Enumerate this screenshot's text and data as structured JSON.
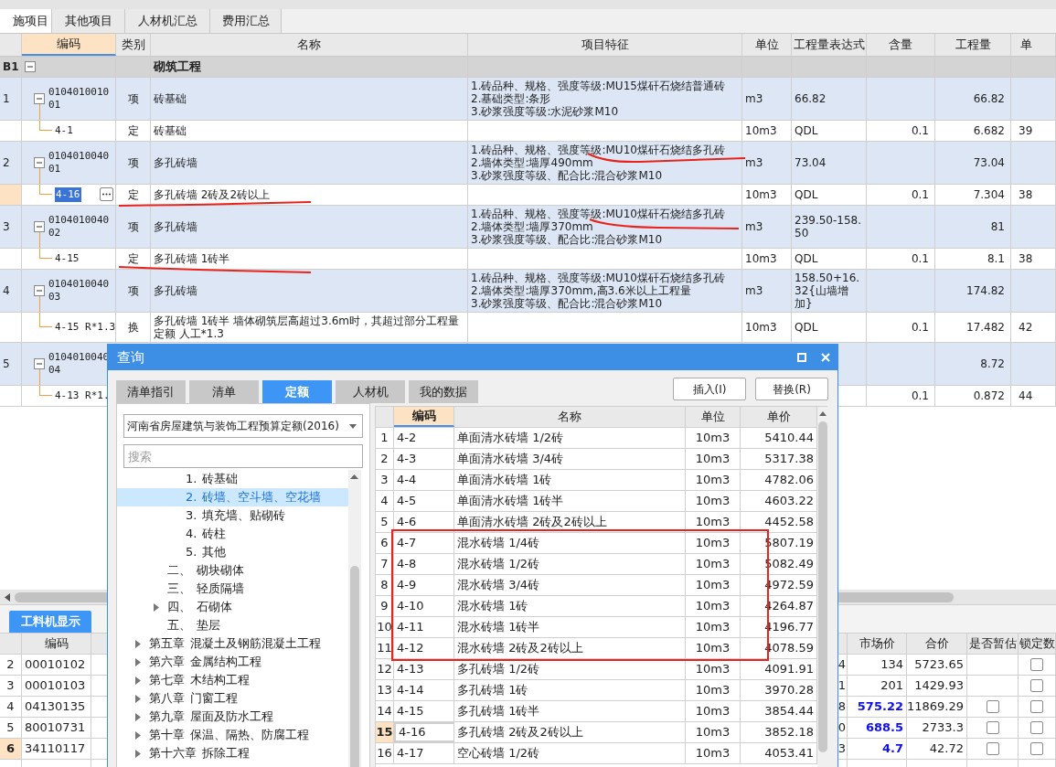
{
  "top_tabs": [
    {
      "label": "施项目",
      "selected": true
    },
    {
      "label": "其他项目",
      "selected": false
    },
    {
      "label": "人材机汇总",
      "selected": false
    },
    {
      "label": "费用汇总",
      "selected": false
    }
  ],
  "main_table": {
    "columns": [
      "",
      "编码",
      "类别",
      "名称",
      "项目特征",
      "单位",
      "工程量表达式",
      "含量",
      "工程量",
      "单"
    ],
    "rows": [
      {
        "kind": "section",
        "num": "B1",
        "expanded": true,
        "name": "砌筑工程",
        "selected": false
      },
      {
        "kind": "item",
        "num": "1",
        "code": "010401001001",
        "expanded": true,
        "type": "项",
        "name": "砖基础",
        "features": [
          "1.砖品种、规格、强度等级:MU15煤矸石烧结普通砖",
          "2.基础类型:条形",
          "3.砂浆强度等级:水泥砂浆M10"
        ],
        "unit": "m3",
        "expr": "66.82",
        "qty": "66.82",
        "selected": false
      },
      {
        "kind": "quota",
        "code": "4-1",
        "type": "定",
        "name": "砖基础",
        "unit": "10m3",
        "expr": "QDL",
        "content": "0.1",
        "qty": "6.682",
        "price": "39",
        "selected": false
      },
      {
        "kind": "item",
        "num": "2",
        "code": "010401004001",
        "expanded": true,
        "type": "项",
        "name": "多孔砖墙",
        "features": [
          "1.砖品种、规格、强度等级:MU10煤矸石烧结多孔砖",
          "2.墙体类型:墙厚490mm",
          "3.砂浆强度等级、配合比:混合砂浆M10"
        ],
        "unit": "m3",
        "expr": "73.04",
        "qty": "73.04",
        "selected": false
      },
      {
        "kind": "quota",
        "code": "4-16",
        "type": "定",
        "name": "多孔砖墙 2砖及2砖以上",
        "unit": "10m3",
        "expr": "QDL",
        "content": "0.1",
        "qty": "7.304",
        "price": "38",
        "selected": true
      },
      {
        "kind": "item",
        "num": "3",
        "code": "010401004002",
        "expanded": true,
        "type": "项",
        "name": "多孔砖墙",
        "features": [
          "1.砖品种、规格、强度等级:MU10煤矸石烧结多孔砖",
          "2.墙体类型:墙厚370mm",
          "3.砂浆强度等级、配合比:混合砂浆M10"
        ],
        "unit": "m3",
        "expr": "239.50-158.50",
        "qty": "81",
        "selected": false
      },
      {
        "kind": "quota",
        "code": "4-15",
        "type": "定",
        "name": "多孔砖墙 1砖半",
        "unit": "10m3",
        "expr": "QDL",
        "content": "0.1",
        "qty": "8.1",
        "price": "38",
        "selected": false
      },
      {
        "kind": "item",
        "num": "4",
        "code": "010401004003",
        "expanded": true,
        "type": "项",
        "name": "多孔砖墙",
        "features": [
          "1.砖品种、规格、强度等级:MU10煤矸石烧结多孔砖",
          "2.墙体类型:墙厚370mm,高3.6米以上工程量",
          "3.砂浆强度等级、配合比:混合砂浆M10"
        ],
        "unit": "m3",
        "expr": "158.50+16.32{山墙增加}",
        "qty": "174.82",
        "selected": false
      },
      {
        "kind": "quota",
        "code": "4-15 R*1.3",
        "type": "换",
        "name": "多孔砖墙 1砖半  墙体砌筑层高超过3.6m时，其超过部分工程量定额 人工*1.3",
        "unit": "10m3",
        "expr": "QDL",
        "content": "0.1",
        "qty": "17.482",
        "price": "42",
        "selected": false
      },
      {
        "kind": "item",
        "num": "5",
        "code": "010401004004",
        "expanded": true,
        "qty": "8.72",
        "selected": false
      },
      {
        "kind": "quota",
        "code": "4-13 R*1.",
        "content": "0.1",
        "qty": "0.872",
        "price": "44",
        "selected": false
      }
    ]
  },
  "dialog": {
    "title": "查询",
    "tabs": [
      {
        "label": "清单指引",
        "selected": false
      },
      {
        "label": "清单",
        "selected": false
      },
      {
        "label": "定额",
        "selected": true
      },
      {
        "label": "人材机",
        "selected": false
      },
      {
        "label": "我的数据",
        "selected": false
      }
    ],
    "buttons": [
      "插入(I)",
      "替换(R)"
    ],
    "library": "河南省房屋建筑与装饰工程预算定额(2016)",
    "search_placeholder": "搜索",
    "tree": [
      {
        "children": [
          {
            "children": [
              {
                "num": "1.",
                "label": "砖基础",
                "selected": false
              },
              {
                "num": "2.",
                "label": "砖墙、空斗墙、空花墙",
                "selected": true
              },
              {
                "num": "3.",
                "label": "填充墙、贴砌砖",
                "selected": false
              },
              {
                "num": "4.",
                "label": "砖柱",
                "selected": false
              },
              {
                "num": "5.",
                "label": "其他",
                "selected": false
              }
            ]
          },
          {
            "num": "二、",
            "label": "砌块砌体",
            "selected": false
          },
          {
            "num": "三、",
            "label": "轻质隔墙",
            "selected": false
          },
          {
            "num": "四、",
            "label": "石砌体",
            "expanded": false,
            "selected": false
          },
          {
            "num": "五、",
            "label": "垫层",
            "selected": false
          }
        ]
      },
      {
        "num": "第五章",
        "label": "混凝土及钢筋混凝土工程",
        "expanded": false,
        "selected": false
      },
      {
        "num": "第六章",
        "label": "金属结构工程",
        "expanded": false,
        "selected": false
      },
      {
        "num": "第七章",
        "label": "木结构工程",
        "expanded": false,
        "selected": false
      },
      {
        "num": "第八章",
        "label": "门窗工程",
        "expanded": false,
        "selected": false
      },
      {
        "num": "第九章",
        "label": "屋面及防水工程",
        "expanded": false,
        "selected": false
      },
      {
        "num": "第十章",
        "label": "保温、隔热、防腐工程",
        "expanded": false,
        "selected": false
      },
      {
        "num": "第十六章",
        "label": "拆除工程",
        "expanded": false,
        "selected": false
      }
    ],
    "table": {
      "columns": [
        "编码",
        "名称",
        "单位",
        "单价"
      ],
      "rows": [
        {
          "num": "1",
          "code": "4-2",
          "name": "单面清水砖墙 1/2砖",
          "unit": "10m3",
          "price": "5410.44",
          "selected": false
        },
        {
          "num": "2",
          "code": "4-3",
          "name": "单面清水砖墙 3/4砖",
          "unit": "10m3",
          "price": "5317.38",
          "selected": false
        },
        {
          "num": "3",
          "code": "4-4",
          "name": "单面清水砖墙 1砖",
          "unit": "10m3",
          "price": "4782.06",
          "selected": false
        },
        {
          "num": "4",
          "code": "4-5",
          "name": "单面清水砖墙 1砖半",
          "unit": "10m3",
          "price": "4603.22",
          "selected": false
        },
        {
          "num": "5",
          "code": "4-6",
          "name": "单面清水砖墙 2砖及2砖以上",
          "unit": "10m3",
          "price": "4452.58",
          "selected": false
        },
        {
          "num": "6",
          "code": "4-7",
          "name": "混水砖墙 1/4砖",
          "unit": "10m3",
          "price": "5807.19",
          "selected": false
        },
        {
          "num": "7",
          "code": "4-8",
          "name": "混水砖墙 1/2砖",
          "unit": "10m3",
          "price": "5082.49",
          "selected": false
        },
        {
          "num": "8",
          "code": "4-9",
          "name": "混水砖墙 3/4砖",
          "unit": "10m3",
          "price": "4972.59",
          "selected": false
        },
        {
          "num": "9",
          "code": "4-10",
          "name": "混水砖墙 1砖",
          "unit": "10m3",
          "price": "4264.87",
          "selected": false
        },
        {
          "num": "10",
          "code": "4-11",
          "name": "混水砖墙 1砖半",
          "unit": "10m3",
          "price": "4196.77",
          "selected": false
        },
        {
          "num": "11",
          "code": "4-12",
          "name": "混水砖墙 2砖及2砖以上",
          "unit": "10m3",
          "price": "4078.59",
          "selected": false
        },
        {
          "num": "12",
          "code": "4-13",
          "name": "多孔砖墙 1/2砖",
          "unit": "10m3",
          "price": "4091.91",
          "selected": false
        },
        {
          "num": "13",
          "code": "4-14",
          "name": "多孔砖墙 1砖",
          "unit": "10m3",
          "price": "3970.28",
          "selected": false
        },
        {
          "num": "14",
          "code": "4-15",
          "name": "多孔砖墙 1砖半",
          "unit": "10m3",
          "price": "3854.44",
          "selected": false
        },
        {
          "num": "15",
          "code": "4-16",
          "name": "多孔砖墙 2砖及2砖以上",
          "unit": "10m3",
          "price": "3852.18",
          "selected": true
        },
        {
          "num": "16",
          "code": "4-17",
          "name": "空心砖墙 1/2砖",
          "unit": "10m3",
          "price": "4053.41",
          "selected": false
        }
      ]
    }
  },
  "bottom_panel": {
    "tab": "工料机显示",
    "columns": [
      "编码",
      "市场价",
      "合价",
      "是否暂估",
      "锁定数"
    ],
    "rows": [
      {
        "num": "2",
        "code": "00010102",
        "column_4": "4",
        "market": "134",
        "market_changed": false,
        "total": "5723.65",
        "locked": false,
        "selected": false
      },
      {
        "num": "3",
        "code": "00010103",
        "column_4": "1",
        "market": "201",
        "market_changed": false,
        "total": "1429.93",
        "locked": false,
        "selected": false
      },
      {
        "num": "4",
        "code": "04130135",
        "column_4": "8",
        "market": "575.22",
        "market_changed": true,
        "total": "11869.29",
        "estimated": false,
        "locked": false,
        "selected": false
      },
      {
        "num": "5",
        "code": "80010731",
        "column_4": "0",
        "market": "688.5",
        "market_changed": true,
        "total": "2733.3",
        "estimated": false,
        "locked": false,
        "selected": false
      },
      {
        "num": "6",
        "code": "34110117",
        "column_4": "3",
        "market": "4.7",
        "market_changed": true,
        "total": "42.72",
        "estimated": false,
        "locked": false,
        "selected": true
      }
    ]
  }
}
